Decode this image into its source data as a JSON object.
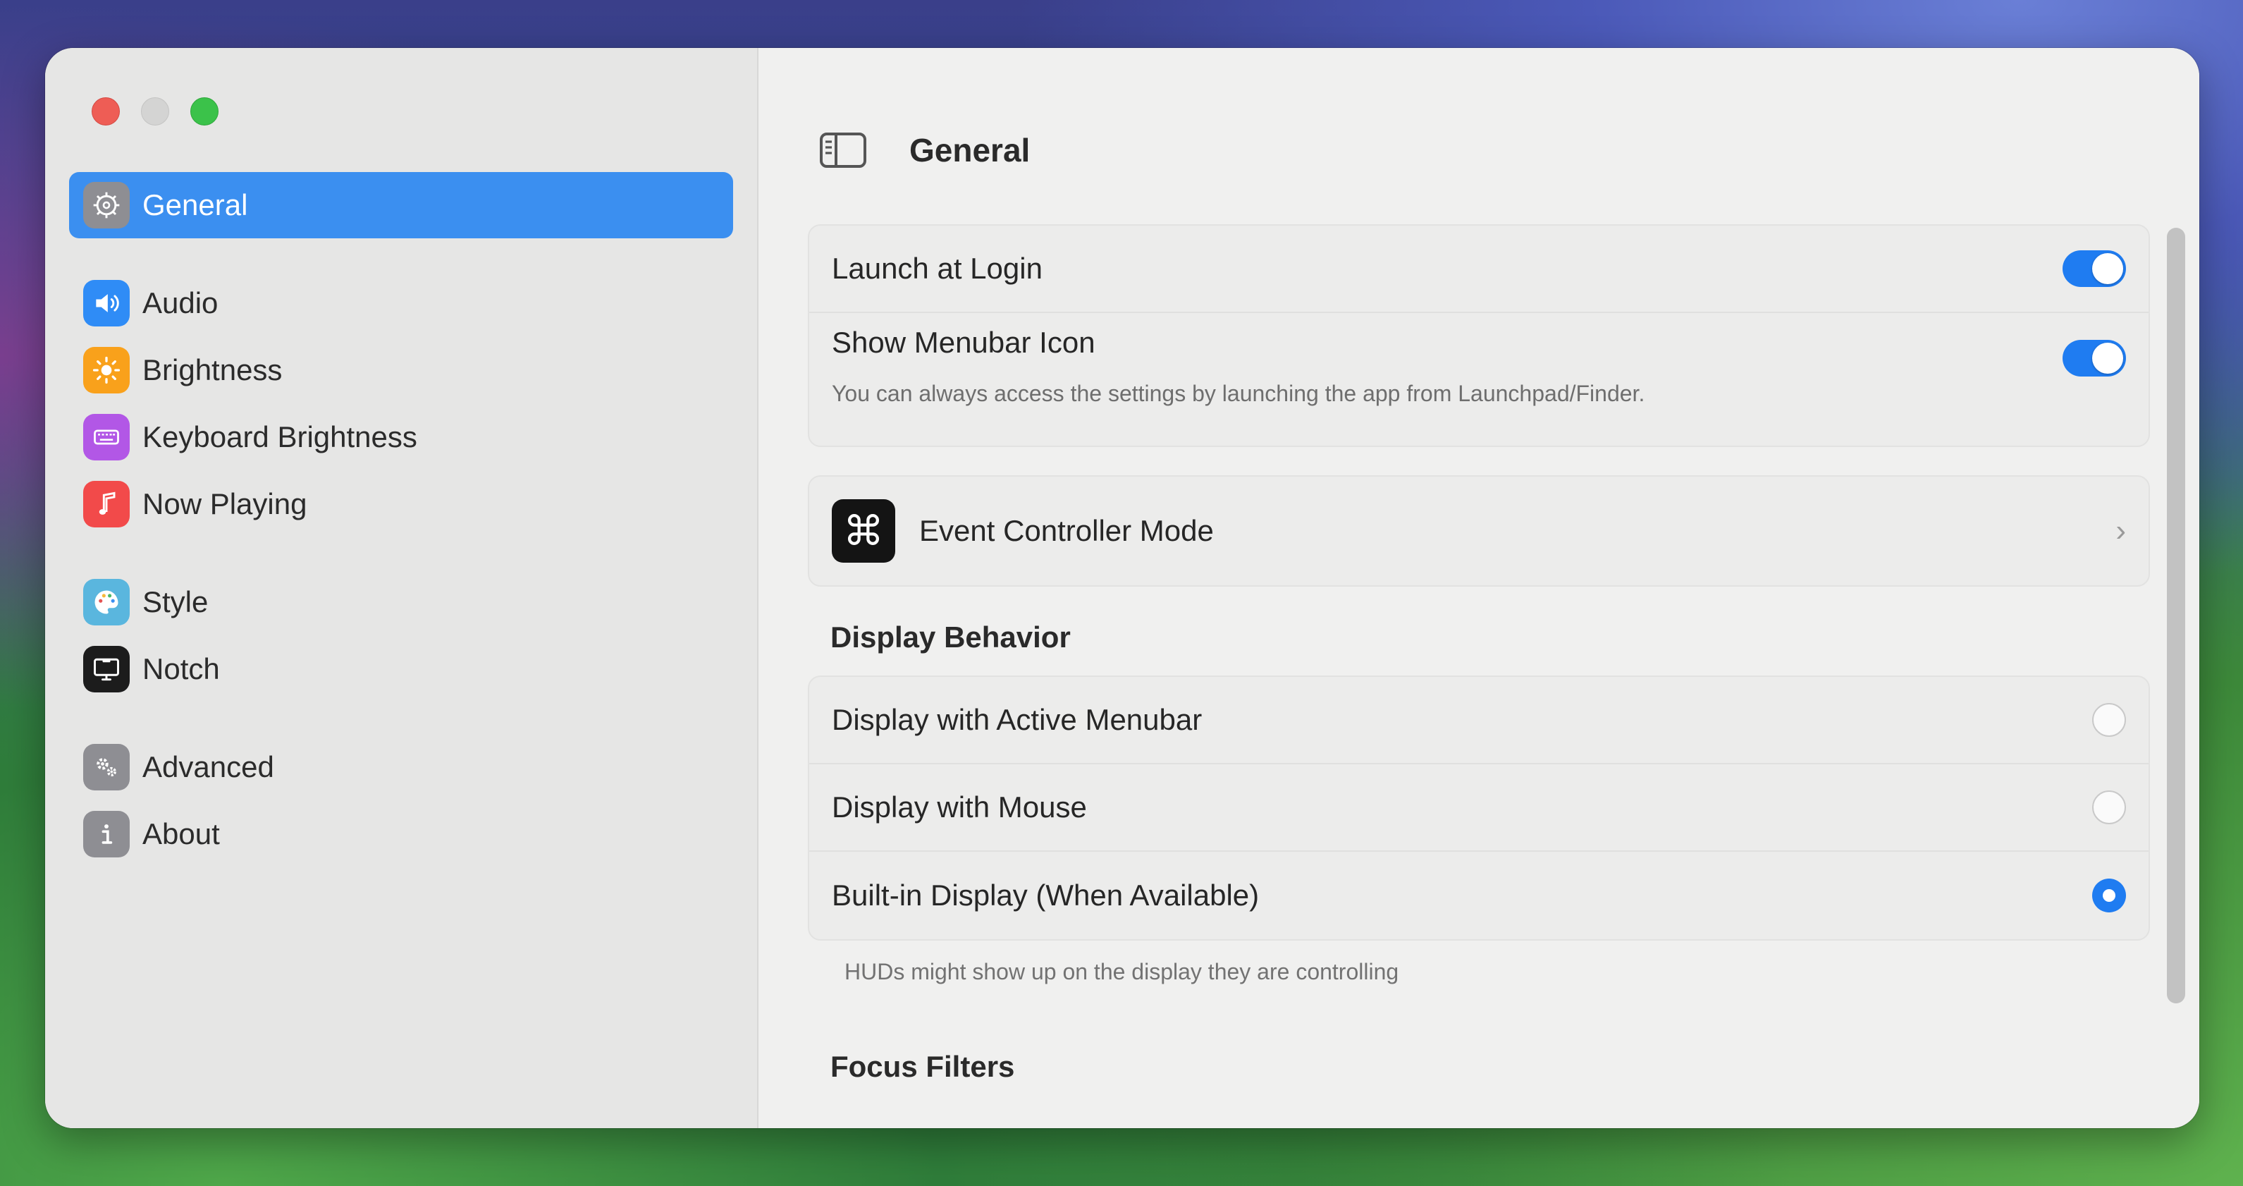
{
  "window": {
    "title": "General"
  },
  "sidebar": {
    "items": [
      {
        "label": "General",
        "icon": "gear-icon",
        "color": "#8e8e93",
        "active": true
      },
      {
        "label": "Audio",
        "icon": "speaker-icon",
        "color": "#2f8cf6"
      },
      {
        "label": "Brightness",
        "icon": "sun-icon",
        "color": "#f9a11b"
      },
      {
        "label": "Keyboard Brightness",
        "icon": "keyboard-icon",
        "color": "#b257e6"
      },
      {
        "label": "Now Playing",
        "icon": "music-note-icon",
        "color": "#f24a4a"
      },
      {
        "label": "Style",
        "icon": "palette-icon",
        "color": "#5ab6de"
      },
      {
        "label": "Notch",
        "icon": "display-icon",
        "color": "#1c1c1c"
      },
      {
        "label": "Advanced",
        "icon": "gears-icon",
        "color": "#8e8e93"
      },
      {
        "label": "About",
        "icon": "info-icon",
        "color": "#8e8e93"
      }
    ]
  },
  "general": {
    "launch_at_login": {
      "label": "Launch at Login",
      "on": true
    },
    "show_menubar_icon": {
      "label": "Show Menubar Icon",
      "on": true,
      "description": "You can always access the settings by launching the app from Launchpad/Finder."
    },
    "event_controller": {
      "label": "Event Controller Mode",
      "icon": "command-icon"
    }
  },
  "display_behavior": {
    "title": "Display Behavior",
    "options": [
      {
        "label": "Display with Active Menubar",
        "selected": false
      },
      {
        "label": "Display with Mouse",
        "selected": false
      },
      {
        "label": "Built-in Display (When Available)",
        "selected": true
      }
    ],
    "footnote": "HUDs might show up on the display they are controlling"
  },
  "focus_filters": {
    "title": "Focus Filters"
  },
  "colors": {
    "accent": "#1f7cf1",
    "sidebar_selection": "#3b8ff0"
  }
}
